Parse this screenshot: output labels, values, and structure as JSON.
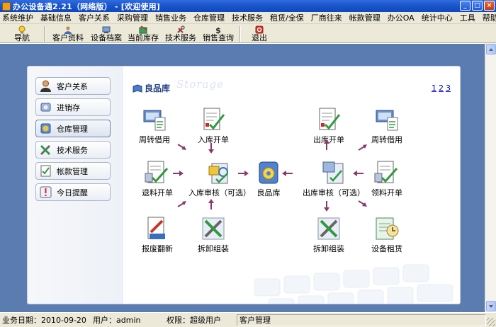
{
  "window": {
    "title": "办公设备通2.21（网络版） - [欢迎使用]",
    "min_label": "_",
    "max_label": "□",
    "close_label": "×"
  },
  "menu": [
    "系统维护",
    "基础信息",
    "客户关系",
    "采购管理",
    "销售业务",
    "仓库管理",
    "技术服务",
    "租赁/全保",
    "厂商往来",
    "帐款管理",
    "办公OA",
    "统计中心",
    "工具",
    "帮助"
  ],
  "toolbar": {
    "nav": "导航",
    "customer": "客户资料",
    "device": "设备档案",
    "stock": "当前库存",
    "tech": "技术服务",
    "sales": "销售查询",
    "exit": "退出"
  },
  "sidebar": {
    "items": [
      {
        "label": "客户关系",
        "icon": "person-icon"
      },
      {
        "label": "进销存",
        "icon": "cart-icon"
      },
      {
        "label": "仓库管理",
        "icon": "warehouse-icon"
      },
      {
        "label": "技术服务",
        "icon": "tools-icon"
      },
      {
        "label": "帐款管理",
        "icon": "ledger-icon"
      },
      {
        "label": "今日提醒",
        "icon": "alert-icon"
      }
    ],
    "active_index": 2
  },
  "panel": {
    "title": "良品库",
    "watermark": "Storage",
    "pages": [
      "1",
      "2",
      "3"
    ]
  },
  "flow": {
    "left_loan": "周转借用",
    "in_order": "入库开单",
    "return_order": "退料开单",
    "in_review": "入库审核（可选）",
    "good_store": "良品库",
    "out_review": "出库审核（可选）",
    "out_order": "出库开单",
    "right_loan": "周转借用",
    "pick_order": "领料开单",
    "scrap": "报废翻新",
    "disassemble_left": "拆卸组装",
    "disassemble_right": "拆卸组装",
    "rental": "设备租赁"
  },
  "status": {
    "date_label": "业务日期：",
    "date": "2010-09-20",
    "user_label": "用户：",
    "user": "admin",
    "role_label": "权限：",
    "role": "超级用户",
    "module": "客户管理"
  },
  "colors": {
    "titlebar": "#1a54c8",
    "workspace": "#5a7cb1",
    "chrome": "#ece9d8",
    "arrow": "#8a3a6a"
  }
}
